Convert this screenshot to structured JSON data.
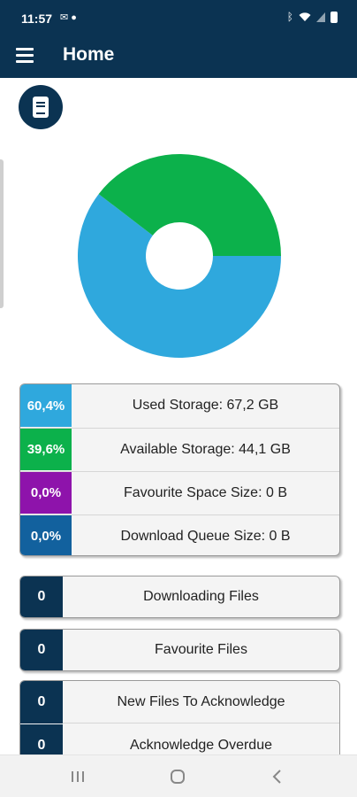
{
  "status_bar": {
    "time": "11:57",
    "left_icons": [
      "mail-icon",
      "chat-icon"
    ],
    "right_icons": [
      "bluetooth-icon",
      "wifi-icon",
      "signal-icon",
      "battery-icon"
    ]
  },
  "app_bar": {
    "title": "Home",
    "menu_icon": "hamburger-menu-icon"
  },
  "doc_button": {
    "icon": "document-icon"
  },
  "chart_data": {
    "type": "pie",
    "style": "donut",
    "slices": [
      {
        "label": "Used Storage",
        "value": 60.4,
        "color": "#2fa8dd"
      },
      {
        "label": "Available Storage",
        "value": 39.6,
        "color": "#0cb14b"
      }
    ]
  },
  "storage": [
    {
      "percent": "60,4%",
      "label": "Used Storage: 67,2 GB",
      "color": "#2fa8dd"
    },
    {
      "percent": "39,6%",
      "label": "Available Storage: 44,1 GB",
      "color": "#0cb14b"
    },
    {
      "percent": "0,0%",
      "label": "Favourite Space Size: 0 B",
      "color": "#8e13ab"
    },
    {
      "percent": "0,0%",
      "label": "Download Queue Size: 0 B",
      "color": "#12619e"
    }
  ],
  "counts": [
    {
      "count": "0",
      "label": "Downloading Files"
    },
    {
      "count": "0",
      "label": "Favourite Files"
    }
  ],
  "acknowledge": [
    {
      "count": "0",
      "label": "New Files To Acknowledge"
    },
    {
      "count": "0",
      "label": "Acknowledge Overdue"
    }
  ],
  "colors": {
    "primary": "#0b3352",
    "card_bg": "#f4f4f4"
  },
  "nav_bar": {
    "buttons": [
      "recent-apps-icon",
      "home-icon",
      "back-icon"
    ]
  }
}
